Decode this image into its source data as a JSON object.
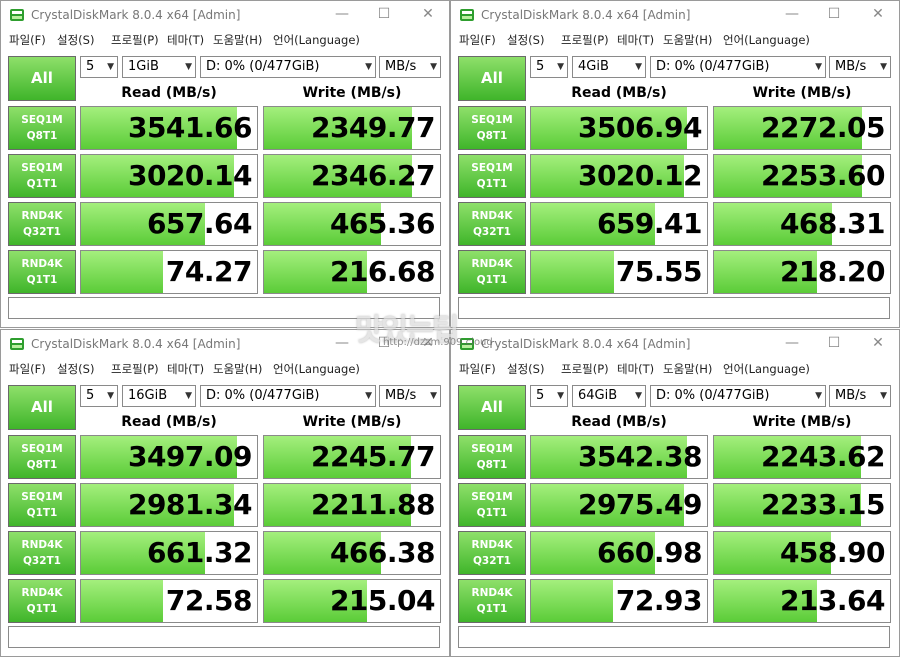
{
  "app": {
    "title": "CrystalDiskMark 8.0.4 x64 [Admin]",
    "menu": [
      "파일(F)",
      "설정(S)",
      "프로필(P)",
      "테마(T)",
      "도움말(H)",
      "언어(Language)"
    ],
    "all_label": "All",
    "read_header": "Read (MB/s)",
    "write_header": "Write (MB/s)",
    "row_labels": [
      [
        "SEQ1M",
        "Q8T1"
      ],
      [
        "SEQ1M",
        "Q1T1"
      ],
      [
        "RND4K",
        "Q32T1"
      ],
      [
        "RND4K",
        "Q1T1"
      ]
    ],
    "accent_color": "#4fc431",
    "icons": {
      "minimize": "minimize-icon",
      "maximize": "maximize-icon",
      "close": "close-icon",
      "app": "disk-app-icon"
    }
  },
  "windows": [
    {
      "count": "5",
      "size": "1GiB",
      "drive": "D: 0% (0/477GiB)",
      "unit": "MB/s",
      "read": [
        "3541.66",
        "3020.14",
        "657.64",
        "74.27"
      ],
      "write": [
        "2349.77",
        "2346.27",
        "465.36",
        "216.68"
      ]
    },
    {
      "count": "5",
      "size": "4GiB",
      "drive": "D: 0% (0/477GiB)",
      "unit": "MB/s",
      "read": [
        "3506.94",
        "3020.12",
        "659.41",
        "75.55"
      ],
      "write": [
        "2272.05",
        "2253.60",
        "468.31",
        "218.20"
      ]
    },
    {
      "count": "5",
      "size": "16GiB",
      "drive": "D: 0% (0/477GiB)",
      "unit": "MB/s",
      "read": [
        "3497.09",
        "2981.34",
        "661.32",
        "72.58"
      ],
      "write": [
        "2245.77",
        "2211.88",
        "466.38",
        "215.04"
      ]
    },
    {
      "count": "5",
      "size": "64GiB",
      "drive": "D: 0% (0/477GiB)",
      "unit": "MB/s",
      "read": [
        "3542.38",
        "2975.49",
        "660.98",
        "72.93"
      ],
      "write": [
        "2243.62",
        "2233.15",
        "458.90",
        "213.64"
      ]
    }
  ],
  "watermark": {
    "logo_text": "맛있는팁",
    "url": "http://dzzm.909.cloud"
  }
}
